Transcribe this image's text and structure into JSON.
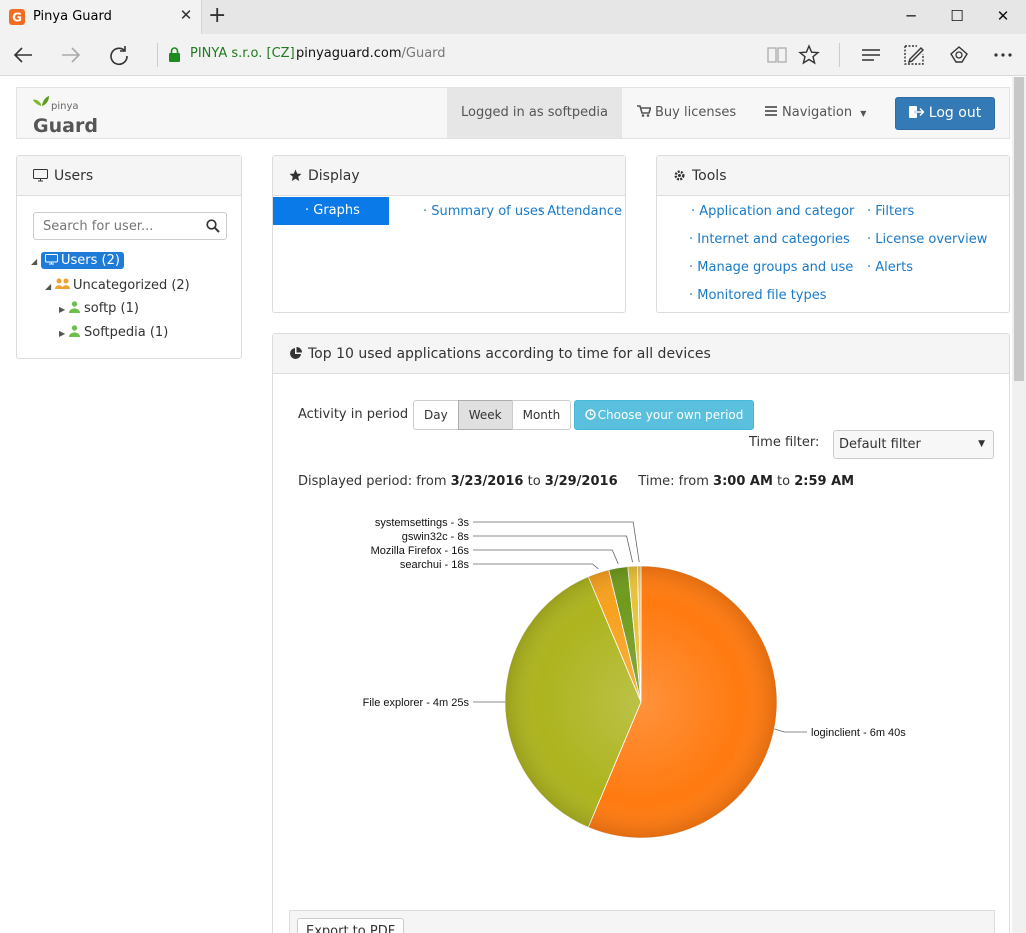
{
  "browser": {
    "tab_title": "Pinya Guard",
    "cert_text": "PINYA s.r.o. [CZ]",
    "url_host": "pinyaguard.com",
    "url_path": "/Guard"
  },
  "header": {
    "logo_small": "pinya",
    "logo_big": "Guard",
    "logged_in": "Logged in as softpedia",
    "buy_licenses": "Buy licenses",
    "navigation": "Navigation",
    "logout": "Log out"
  },
  "users_panel": {
    "title": "Users",
    "search_placeholder": "Search for user...",
    "tree": [
      {
        "label": "Users (2)"
      },
      {
        "label": "Uncategorized (2)"
      },
      {
        "label": "softp (1)"
      },
      {
        "label": "Softpedia (1)"
      }
    ]
  },
  "display_panel": {
    "title": "Display",
    "items": [
      "Graphs",
      "Summary of uses",
      "Attendance"
    ]
  },
  "tools_panel": {
    "title": "Tools",
    "items": [
      "Application and categor",
      "Filters",
      "Internet and categories",
      "License overview",
      "Manage groups and use",
      "Alerts",
      "Monitored file types"
    ]
  },
  "chart_panel": {
    "title": "Top 10 used applications according to time for all devices",
    "activity_label": "Activity in period",
    "periods": [
      "Day",
      "Week",
      "Month"
    ],
    "active_period": "Week",
    "choose_period": "Choose your own period",
    "time_filter_label": "Time filter:",
    "time_filter_value": "Default filter",
    "displayed_label": "Displayed period: from",
    "date_from": "3/23/2016",
    "to_word": "to",
    "date_to": "3/29/2016",
    "time_label": "Time: from",
    "time_from": "3:00 AM",
    "time_to": "2:59 AM",
    "export_label": "Export to PDF"
  },
  "chart_data": {
    "type": "pie",
    "slices": [
      {
        "label": "loginclient - 6m 40s",
        "value": 400,
        "color": "#ff7a10"
      },
      {
        "label": "File explorer - 4m 25s",
        "value": 265,
        "color": "#adb41e"
      },
      {
        "label": "searchui - 18s",
        "value": 18,
        "color": "#f7a11e"
      },
      {
        "label": "Mozilla Firefox - 16s",
        "value": 16,
        "color": "#6f9a1c"
      },
      {
        "label": "gswin32c - 8s",
        "value": 8,
        "color": "#e8c23a"
      },
      {
        "label": "systemsettings - 3s",
        "value": 3,
        "color": "#f2c060"
      }
    ]
  }
}
